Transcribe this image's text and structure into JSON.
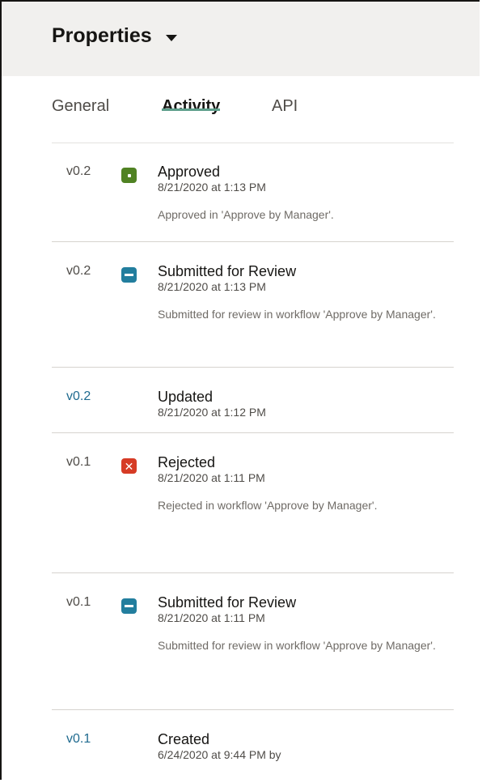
{
  "panel": {
    "title": "Properties"
  },
  "tabs": [
    {
      "label": "General",
      "active": false
    },
    {
      "label": "Activity",
      "active": true
    },
    {
      "label": "API",
      "active": false
    }
  ],
  "activity": [
    {
      "version": "v0.2",
      "status": "approved",
      "icon": "approved-icon",
      "title": "Approved",
      "date": "8/21/2020 at 1:13 PM",
      "description": "Approved in 'Approve by Manager'."
    },
    {
      "version": "v0.2",
      "status": "submitted",
      "icon": "submitted-icon",
      "title": "Submitted for Review",
      "date": "8/21/2020 at 1:13 PM",
      "description": "Submitted for review in workflow 'Approve by Manager'."
    },
    {
      "version": "v0.2",
      "status": "updated",
      "icon": "",
      "title": "Updated",
      "date": "8/21/2020 at 1:12 PM",
      "description": ""
    },
    {
      "version": "v0.1",
      "status": "rejected",
      "icon": "rejected-icon",
      "title": "Rejected",
      "date": "8/21/2020 at 1:11 PM",
      "description": "Rejected in workflow 'Approve by Manager'."
    },
    {
      "version": "v0.1",
      "status": "submitted",
      "icon": "submitted-icon",
      "title": "Submitted for Review",
      "date": "8/21/2020 at 1:11 PM",
      "description": "Submitted for review in workflow 'Approve by Manager'."
    },
    {
      "version": "v0.1",
      "status": "created",
      "icon": "",
      "title": "Created",
      "date": "6/24/2020 at 9:44 PM by",
      "description": ""
    }
  ],
  "colors": {
    "approved": "#508223",
    "submitted": "#227e9e",
    "rejected": "#d63b25",
    "tab_underline": "#5e9f8c",
    "link": "#1f6a8f"
  }
}
